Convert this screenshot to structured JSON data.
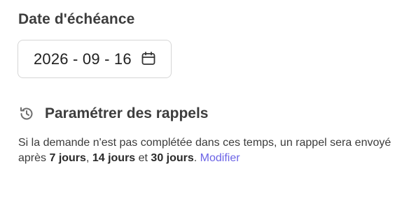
{
  "due_date": {
    "label": "Date d'échéance",
    "value": "2026 - 09 - 16",
    "icon": "calendar-icon"
  },
  "reminders": {
    "icon": "history-icon",
    "title": "Paramétrer des rappels",
    "desc_prefix": "Si la demande n'est pas complétée dans ces temps, un rappel sera envoyé après ",
    "interval_1": "7 jours",
    "sep_1": ", ",
    "interval_2": "14 jours",
    "sep_2": " et ",
    "interval_3": "30 jours",
    "desc_suffix": ". ",
    "modify_label": "Modifier"
  },
  "colors": {
    "link": "#6b63e6",
    "border": "#d6d6d6",
    "text": "#3d3d3d"
  }
}
